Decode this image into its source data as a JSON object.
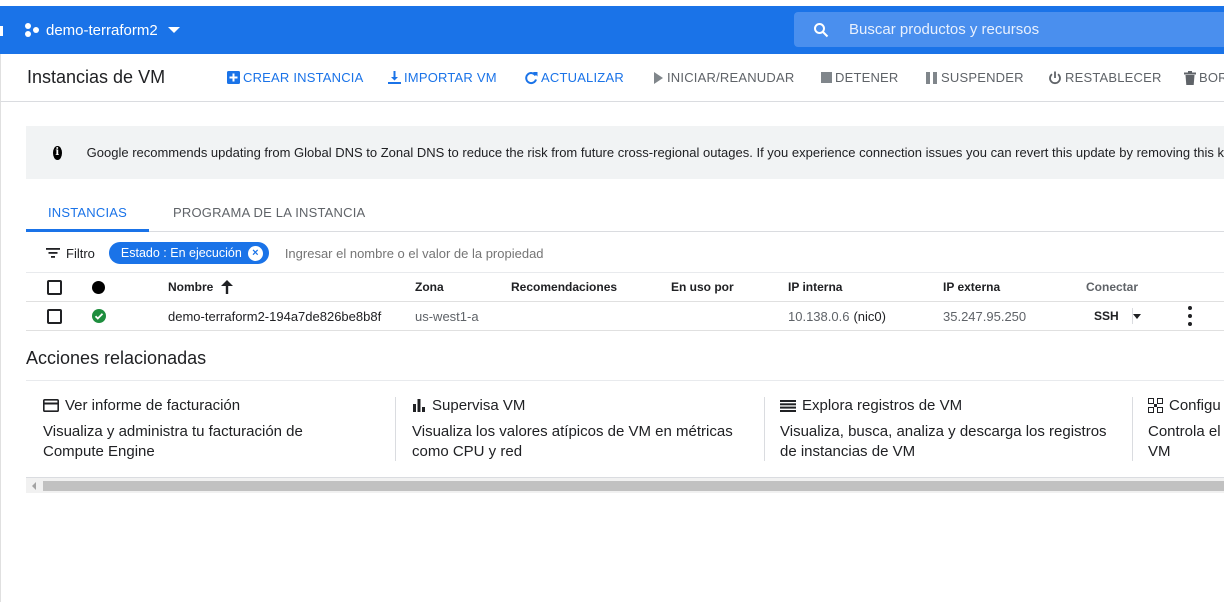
{
  "topbar": {
    "project_name": "demo-terraform2",
    "search_placeholder": "Buscar productos y recursos"
  },
  "actionbar": {
    "title": "Instancias de VM",
    "actions": [
      {
        "label": "CREAR INSTANCIA",
        "icon": "add-box-icon",
        "enabled": true
      },
      {
        "label": "IMPORTAR VM",
        "icon": "download-icon",
        "enabled": true
      },
      {
        "label": "ACTUALIZAR",
        "icon": "refresh-icon",
        "enabled": true
      },
      {
        "label": "INICIAR/REANUDAR",
        "icon": "play-icon",
        "enabled": false
      },
      {
        "label": "DETENER",
        "icon": "stop-icon",
        "enabled": false
      },
      {
        "label": "SUSPENDER",
        "icon": "pause-icon",
        "enabled": false
      },
      {
        "label": "RESTABLECER",
        "icon": "power-icon",
        "enabled": false
      },
      {
        "label": "BOR",
        "icon": "trash-icon",
        "enabled": false
      }
    ]
  },
  "banner": {
    "icon": "info-icon",
    "text": "Google recommends updating from Global DNS to Zonal DNS to reduce the risk from future cross-regional outages. If you experience connection issues you can revert this update by removing this k"
  },
  "tabs": [
    {
      "label": "INSTANCIAS",
      "active": true
    },
    {
      "label": "PROGRAMA DE LA INSTANCIA",
      "active": false
    }
  ],
  "filter": {
    "label": "Filtro",
    "chip": "Estado : En ejecución",
    "placeholder": "Ingresar el nombre o el valor de la propiedad"
  },
  "table": {
    "columns": {
      "name": "Nombre",
      "zone": "Zona",
      "recommendations": "Recomendaciones",
      "in_use_by": "En uso por",
      "internal_ip": "IP interna",
      "external_ip": "IP externa",
      "connect": "Conectar"
    },
    "rows": [
      {
        "status": "running",
        "name": "demo-terraform2-194a7de826be8b8f",
        "zone": "us-west1-a",
        "recommendations": "",
        "in_use_by": "",
        "internal_ip": "10.138.0.6",
        "internal_nic": "(nic0)",
        "external_ip": "35.247.95.250",
        "connect": "SSH"
      }
    ]
  },
  "related": {
    "title": "Acciones relacionadas",
    "cards": [
      {
        "icon": "credit-card-icon",
        "title": "Ver informe de facturación",
        "line1": "Visualiza y administra tu facturación de",
        "line2": "Compute Engine"
      },
      {
        "icon": "bar-chart-icon",
        "title": "Supervisa VM",
        "line1": "Visualiza los valores atípicos de VM en métricas",
        "line2": "como CPU y red"
      },
      {
        "icon": "list-icon",
        "title": "Explora registros de VM",
        "line1": "Visualiza, busca, analiza y descarga los registros",
        "line2": "de instancias de VM"
      },
      {
        "icon": "grid-icon",
        "title": "Configu",
        "line1": "Controla el",
        "line2": "VM"
      }
    ]
  },
  "colors": {
    "brand_blue": "#1a73e8",
    "status_green": "#1e8e3e",
    "disabled_grey": "#5f6368"
  }
}
